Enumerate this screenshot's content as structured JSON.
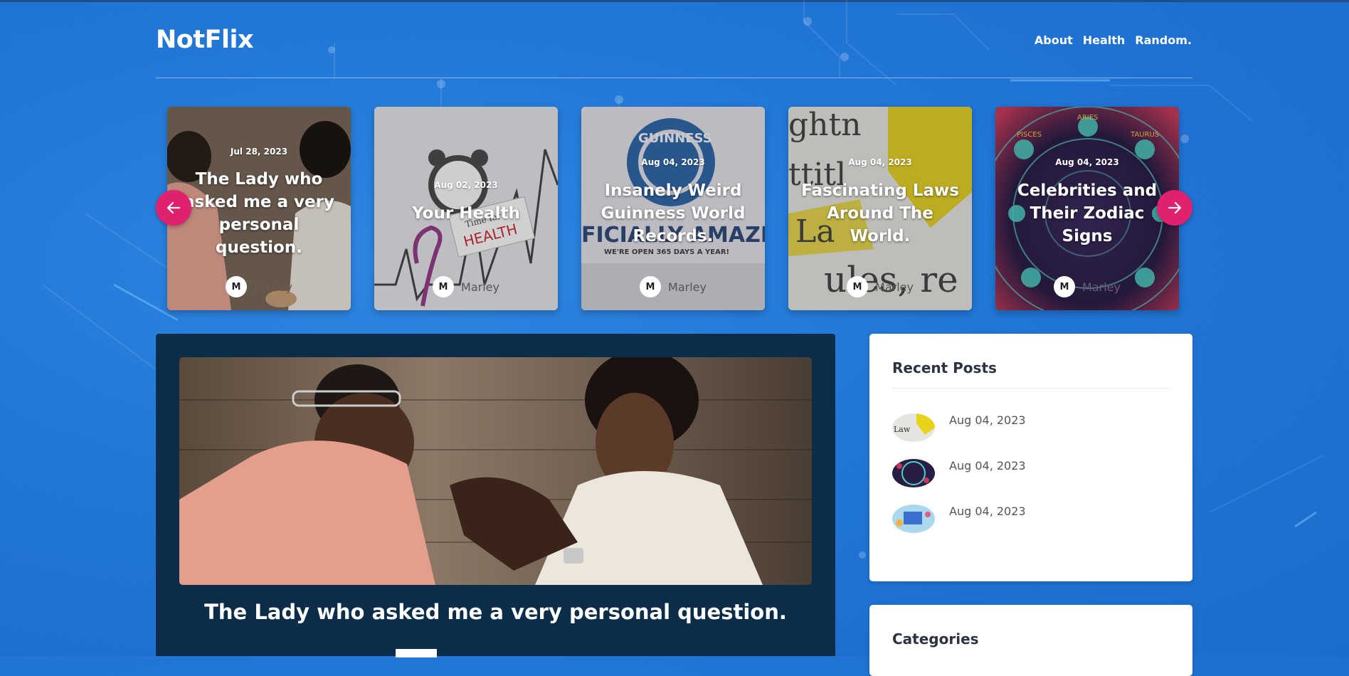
{
  "brand": {
    "logo": "NotFlix"
  },
  "nav": {
    "items": [
      "About",
      "Health",
      "Random."
    ]
  },
  "carousel": {
    "cards": [
      {
        "date": "Jul 28, 2023",
        "title": "The Lady who asked me a very personal question.",
        "author": "Marley"
      },
      {
        "date": "Aug 02, 2023",
        "title": "Your Health",
        "author": "Marley"
      },
      {
        "date": "Aug 04, 2023",
        "title": "Insanely Weird Guinness World Records.",
        "author": "Marley"
      },
      {
        "date": "Aug 04, 2023",
        "title": "Fascinating Laws Around The World.",
        "author": "Marley"
      },
      {
        "date": "Aug 04, 2023",
        "title": "Celebrities and Their Zodiac Signs",
        "author": "Marley"
      }
    ],
    "prev_icon": "arrow-left-icon",
    "next_icon": "arrow-right-icon",
    "accent": "#e0216f"
  },
  "featured": {
    "title": "The Lady who asked me a very personal question."
  },
  "sidebar": {
    "recent": {
      "heading": "Recent Posts",
      "posts": [
        {
          "date": "Aug 04, 2023"
        },
        {
          "date": "Aug 04, 2023"
        },
        {
          "date": "Aug 04, 2023"
        }
      ]
    },
    "categories": {
      "heading": "Categories"
    }
  }
}
